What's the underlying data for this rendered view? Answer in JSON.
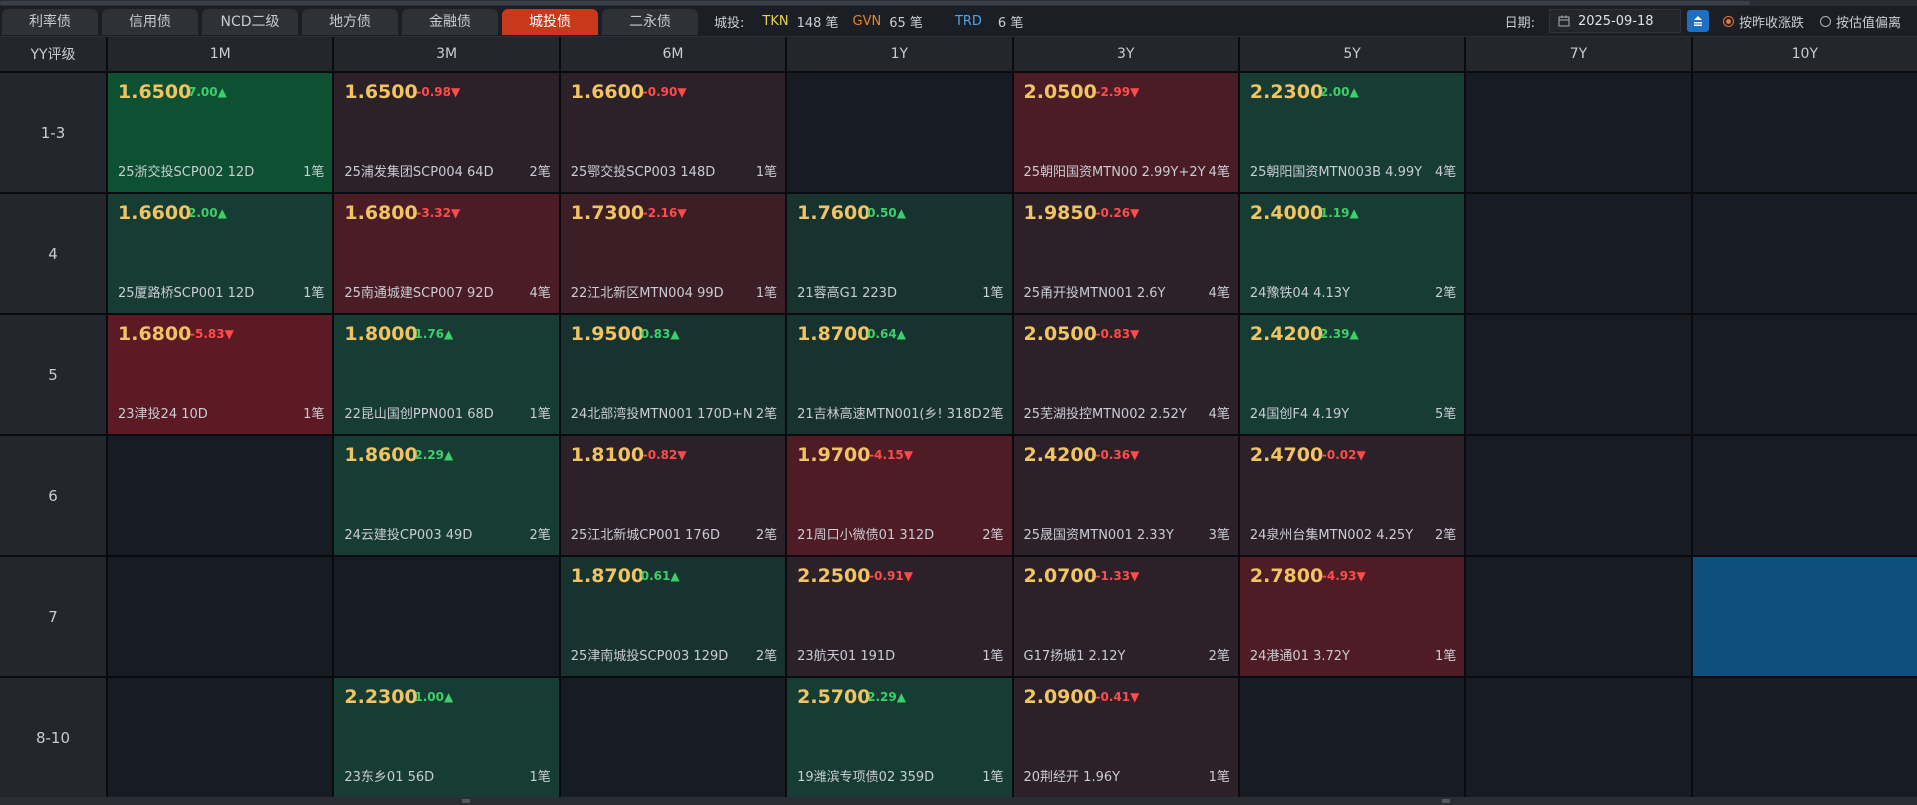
{
  "tabs": [
    {
      "label": "利率债",
      "active": false
    },
    {
      "label": "信用债",
      "active": false
    },
    {
      "label": "NCD二级",
      "active": false
    },
    {
      "label": "地方债",
      "active": false
    },
    {
      "label": "金融债",
      "active": false
    },
    {
      "label": "城投债",
      "active": true
    },
    {
      "label": "二永债",
      "active": false
    }
  ],
  "stats": {
    "label": "城投:",
    "items": [
      {
        "code": "TKN",
        "count": "148 笔",
        "color": "#e8d24a"
      },
      {
        "code": "GVN",
        "count": "65 笔",
        "color": "#e8832c"
      },
      {
        "code": "TRD",
        "count": "6 笔",
        "color": "#4fa3e8"
      }
    ]
  },
  "date": {
    "label": "日期:",
    "value": "2025-09-18"
  },
  "radios": [
    {
      "label": "按昨收涨跌",
      "selected": true
    },
    {
      "label": "按估值偏离",
      "selected": false
    }
  ],
  "grid": {
    "corner": "YY评级",
    "columns": [
      "1M",
      "3M",
      "6M",
      "1Y",
      "3Y",
      "5Y",
      "7Y",
      "10Y"
    ],
    "rows": [
      {
        "label": "1-3",
        "cells": [
          {
            "rate": "1.6500",
            "change": "7.00▲",
            "dir": "up",
            "bond": "25浙交投SCP002 12D",
            "count": "1笔",
            "bg": "#0e5032"
          },
          {
            "rate": "1.6500",
            "change": "-0.98▼",
            "dir": "down",
            "bond": "25浦发集团SCP004 64D",
            "count": "2笔",
            "bg": "#2c2129"
          },
          {
            "rate": "1.6600",
            "change": "-0.90▼",
            "dir": "down",
            "bond": "25鄂交投SCP003 148D",
            "count": "1笔",
            "bg": "#2c2129"
          },
          null,
          {
            "rate": "2.0500",
            "change": "-2.99▼",
            "dir": "down",
            "bond": "25朝阳国资MTN00 2.99Y+2Y",
            "count": "4笔",
            "bg": "#4a1d26"
          },
          {
            "rate": "2.2300",
            "change": "2.00▲",
            "dir": "up",
            "bond": "25朝阳国资MTN003B 4.99Y",
            "count": "4笔",
            "bg": "#173c33"
          },
          null,
          null
        ]
      },
      {
        "label": "4",
        "cells": [
          {
            "rate": "1.6600",
            "change": "2.00▲",
            "dir": "up",
            "bond": "25厦路桥SCP001 12D",
            "count": "1笔",
            "bg": "#173c33"
          },
          {
            "rate": "1.6800",
            "change": "-3.32▼",
            "dir": "down",
            "bond": "25南通城建SCP007 92D",
            "count": "4笔",
            "bg": "#4a1d26"
          },
          {
            "rate": "1.7300",
            "change": "-2.16▼",
            "dir": "down",
            "bond": "22江北新区MTN004 99D",
            "count": "1笔",
            "bg": "#3c1e27"
          },
          {
            "rate": "1.7600",
            "change": "0.50▲",
            "dir": "up",
            "bond": "21蓉高G1 223D",
            "count": "1笔",
            "bg": "#18322f"
          },
          {
            "rate": "1.9850",
            "change": "-0.26▼",
            "dir": "down",
            "bond": "25甬开投MTN001 2.6Y",
            "count": "4笔",
            "bg": "#2c2129"
          },
          {
            "rate": "2.4000",
            "change": "1.19▲",
            "dir": "up",
            "bond": "24豫铁04 4.13Y",
            "count": "2笔",
            "bg": "#173c33"
          },
          null,
          null
        ]
      },
      {
        "label": "5",
        "cells": [
          {
            "rate": "1.6800",
            "change": "-5.83▼",
            "dir": "down",
            "bond": "23津投24 10D",
            "count": "1笔",
            "bg": "#5c1a24"
          },
          {
            "rate": "1.8000",
            "change": "1.76▲",
            "dir": "up",
            "bond": "22昆山国创PPN001 68D",
            "count": "1笔",
            "bg": "#173c33"
          },
          {
            "rate": "1.9500",
            "change": "0.83▲",
            "dir": "up",
            "bond": "24北部湾投MTN001 170D+N",
            "count": "2笔",
            "bg": "#18322f"
          },
          {
            "rate": "1.8700",
            "change": "0.64▲",
            "dir": "up",
            "bond": "21吉林高速MTN001(乡! 318D",
            "count": "2笔",
            "bg": "#18322f"
          },
          {
            "rate": "2.0500",
            "change": "-0.83▼",
            "dir": "down",
            "bond": "25芜湖投控MTN002 2.52Y",
            "count": "4笔",
            "bg": "#2c2129"
          },
          {
            "rate": "2.4200",
            "change": "2.39▲",
            "dir": "up",
            "bond": "24国创F4 4.19Y",
            "count": "5笔",
            "bg": "#173c33"
          },
          null,
          null
        ]
      },
      {
        "label": "6",
        "cells": [
          null,
          {
            "rate": "1.8600",
            "change": "2.29▲",
            "dir": "up",
            "bond": "24云建投CP003 49D",
            "count": "2笔",
            "bg": "#173c33"
          },
          {
            "rate": "1.8100",
            "change": "-0.82▼",
            "dir": "down",
            "bond": "25江北新城CP001 176D",
            "count": "2笔",
            "bg": "#2c2129"
          },
          {
            "rate": "1.9700",
            "change": "-4.15▼",
            "dir": "down",
            "bond": "21周口小微债01 312D",
            "count": "2笔",
            "bg": "#4f1c25"
          },
          {
            "rate": "2.4200",
            "change": "-0.36▼",
            "dir": "down",
            "bond": "25晟国资MTN001 2.33Y",
            "count": "3笔",
            "bg": "#2c2129"
          },
          {
            "rate": "2.4700",
            "change": "-0.02▼",
            "dir": "down",
            "bond": "24泉州台集MTN002 4.25Y",
            "count": "2笔",
            "bg": "#2c2129"
          },
          null,
          null
        ]
      },
      {
        "label": "7",
        "cells": [
          null,
          null,
          {
            "rate": "1.8700",
            "change": "0.61▲",
            "dir": "up",
            "bond": "25津南城投SCP003 129D",
            "count": "2笔",
            "bg": "#18322f"
          },
          {
            "rate": "2.2500",
            "change": "-0.91▼",
            "dir": "down",
            "bond": "23航天01 191D",
            "count": "1笔",
            "bg": "#2c2129"
          },
          {
            "rate": "2.0700",
            "change": "-1.33▼",
            "dir": "down",
            "bond": "G17扬城1 2.12Y",
            "count": "2笔",
            "bg": "#2c2129"
          },
          {
            "rate": "2.7800",
            "change": "-4.93▼",
            "dir": "down",
            "bond": "24港通01 3.72Y",
            "count": "1笔",
            "bg": "#4f1c25"
          },
          null,
          {
            "blue": true
          }
        ]
      },
      {
        "label": "8-10",
        "cells": [
          null,
          {
            "rate": "2.2300",
            "change": "1.00▲",
            "dir": "up",
            "bond": "23东乡01 56D",
            "count": "1笔",
            "bg": "#173c33"
          },
          null,
          {
            "rate": "2.5700",
            "change": "2.29▲",
            "dir": "up",
            "bond": "19潍滨专项债02 359D",
            "count": "1笔",
            "bg": "#173c33"
          },
          {
            "rate": "2.0900",
            "change": "-0.41▼",
            "dir": "down",
            "bond": "20荆经开 1.96Y",
            "count": "1笔",
            "bg": "#2c2129"
          },
          null,
          null,
          null
        ]
      }
    ]
  },
  "colors": {
    "up": "#3ccf6a",
    "down": "#ff4b4b",
    "rate": "#f0c463",
    "accent": "#c8391c"
  }
}
